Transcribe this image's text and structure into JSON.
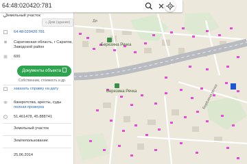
{
  "search": {
    "query": "64:48:020420:781"
  },
  "panel": {
    "title": "Земельный участок",
    "tab_label": "Дом (здание)",
    "cadastral_number": "64:48:020420:781",
    "address_line1": "Саратовская область, г Саратов,",
    "address_line2": "Заводской район",
    "area": "600",
    "documents_button": "Документы объекта",
    "documents_sub": "Собственник, стоимость и др.",
    "order_link": "заказать справку на дату",
    "checks_line": "банкротства, аресты, суды",
    "full_check_link": "полная проверка",
    "coords": "51.461478, 45.888741",
    "type_value": "Земельный участок",
    "category_value": "Землепользование",
    "date_value": "25.06.2014"
  },
  "map": {
    "labels": {
      "stop_label": "Березина Речка",
      "station_label": "Березина Речка",
      "street_label": "Берёзина речка",
      "corner_label": "Ди"
    }
  },
  "colors": {
    "accent_green": "#2ea44f",
    "road": "#b8bcc1",
    "parcel_pink": "#e64ad6",
    "parcel_blue": "#1e55d6",
    "map_bg": "#ede8dc"
  }
}
